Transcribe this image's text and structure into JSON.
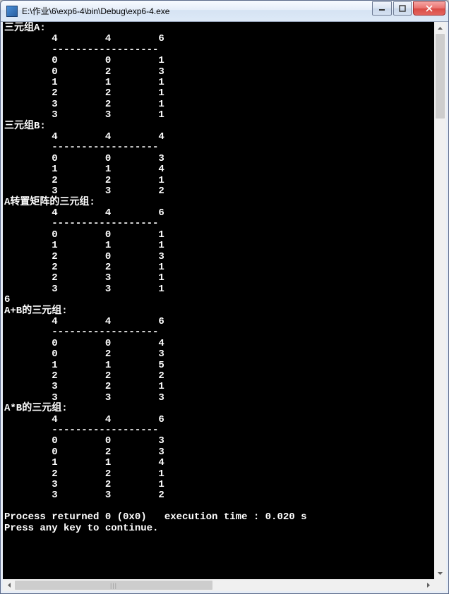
{
  "window": {
    "title": "E:\\作业\\6\\exp6-4\\bin\\Debug\\exp6-4.exe"
  },
  "sections": [
    {
      "label": "三元组A:",
      "header": [
        4,
        4,
        6
      ],
      "rows": [
        [
          0,
          0,
          1
        ],
        [
          0,
          2,
          3
        ],
        [
          1,
          1,
          1
        ],
        [
          2,
          2,
          1
        ],
        [
          3,
          2,
          1
        ],
        [
          3,
          3,
          1
        ]
      ]
    },
    {
      "label": "三元组B:",
      "header": [
        4,
        4,
        4
      ],
      "rows": [
        [
          0,
          0,
          3
        ],
        [
          1,
          1,
          4
        ],
        [
          2,
          2,
          1
        ],
        [
          3,
          3,
          2
        ]
      ]
    },
    {
      "label": "A转置矩阵的三元组:",
      "header": [
        4,
        4,
        6
      ],
      "rows": [
        [
          0,
          0,
          1
        ],
        [
          1,
          1,
          1
        ],
        [
          2,
          0,
          3
        ],
        [
          2,
          2,
          1
        ],
        [
          2,
          3,
          1
        ],
        [
          3,
          3,
          1
        ]
      ]
    },
    {
      "label": "6",
      "plain": true
    },
    {
      "label": "A+B的三元组:",
      "header": [
        4,
        4,
        6
      ],
      "rows": [
        [
          0,
          0,
          4
        ],
        [
          0,
          2,
          3
        ],
        [
          1,
          1,
          5
        ],
        [
          2,
          2,
          2
        ],
        [
          3,
          2,
          1
        ],
        [
          3,
          3,
          3
        ]
      ]
    },
    {
      "label": "A*B的三元组:",
      "header": [
        4,
        4,
        6
      ],
      "rows": [
        [
          0,
          0,
          3
        ],
        [
          0,
          2,
          3
        ],
        [
          1,
          1,
          4
        ],
        [
          2,
          2,
          1
        ],
        [
          3,
          2,
          1
        ],
        [
          3,
          3,
          2
        ]
      ]
    }
  ],
  "footer": {
    "line1": "Process returned 0 (0x0)   execution time : 0.020 s",
    "line2": "Press any key to continue."
  },
  "divider": "        ------------------",
  "buttons": {
    "min": "─",
    "max": "▢",
    "close": "✕"
  }
}
